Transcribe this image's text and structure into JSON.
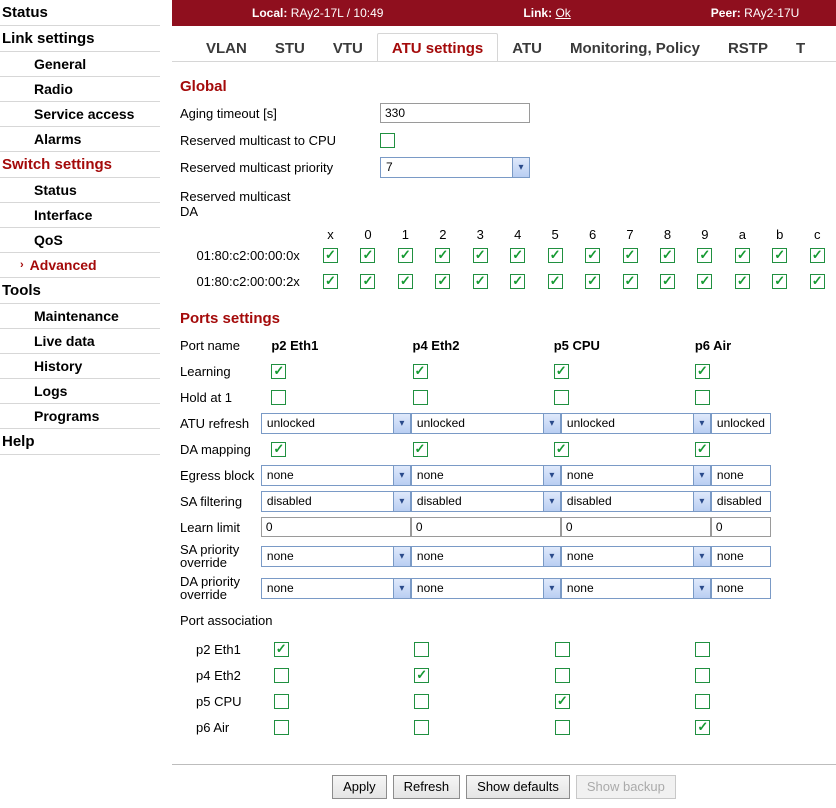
{
  "sidebar": {
    "status": "Status",
    "link_settings": "Link settings",
    "link": {
      "general": "General",
      "radio": "Radio",
      "service": "Service access",
      "alarms": "Alarms"
    },
    "switch_settings": "Switch settings",
    "switch": {
      "status": "Status",
      "interface": "Interface",
      "qos": "QoS",
      "advanced": "Advanced"
    },
    "tools": "Tools",
    "tool": {
      "maintenance": "Maintenance",
      "livedata": "Live data",
      "history": "History",
      "logs": "Logs",
      "programs": "Programs"
    },
    "help": "Help"
  },
  "topbar": {
    "local_label": "Local:",
    "local_val": "RAy2-17L / 10:49",
    "link_label": "Link:",
    "link_val": "Ok",
    "peer_label": "Peer:",
    "peer_val": "RAy2-17U"
  },
  "tabs": {
    "vlan": "VLAN",
    "stu": "STU",
    "vtu": "VTU",
    "atus": "ATU settings",
    "atu": "ATU",
    "mon": "Monitoring, Policy",
    "rstp": "RSTP",
    "extra": "T"
  },
  "global": {
    "title": "Global",
    "aging_label": "Aging timeout [s]",
    "aging_val": "330",
    "res_mc_cpu": "Reserved multicast to CPU",
    "res_mc_prio": "Reserved multicast priority",
    "res_mc_prio_val": "7",
    "res_mc_da": "Reserved multicast DA",
    "cols": [
      "x",
      "0",
      "1",
      "2",
      "3",
      "4",
      "5",
      "6",
      "7",
      "8",
      "9",
      "a",
      "b",
      "c"
    ],
    "rows": [
      {
        "label": "01:80:c2:00:00:0x"
      },
      {
        "label": "01:80:c2:00:00:2x"
      }
    ]
  },
  "ports": {
    "title": "Ports settings",
    "header": {
      "name": "Port name",
      "p2": "p2 Eth1",
      "p4": "p4 Eth2",
      "p5": "p5 CPU",
      "p6": "p6 Air"
    },
    "learning": "Learning",
    "hold": "Hold at 1",
    "aturefresh": "ATU refresh",
    "aturefresh_val": "unlocked",
    "damap": "DA mapping",
    "egress": "Egress block",
    "egress_val": "none",
    "safilter": "SA filtering",
    "safilter_val": "disabled",
    "learnlimit": "Learn limit",
    "learnlimit_val": "0",
    "saprio": "SA priority override",
    "saprio_val": "none",
    "daprio": "DA priority override",
    "daprio_val": "none",
    "portassoc": "Port association",
    "assoc": {
      "p2": "p2 Eth1",
      "p4": "p4 Eth2",
      "p5": "p5 CPU",
      "p6": "p6 Air"
    }
  },
  "buttons": {
    "apply": "Apply",
    "refresh": "Refresh",
    "showdef": "Show defaults",
    "showback": "Show backup"
  }
}
